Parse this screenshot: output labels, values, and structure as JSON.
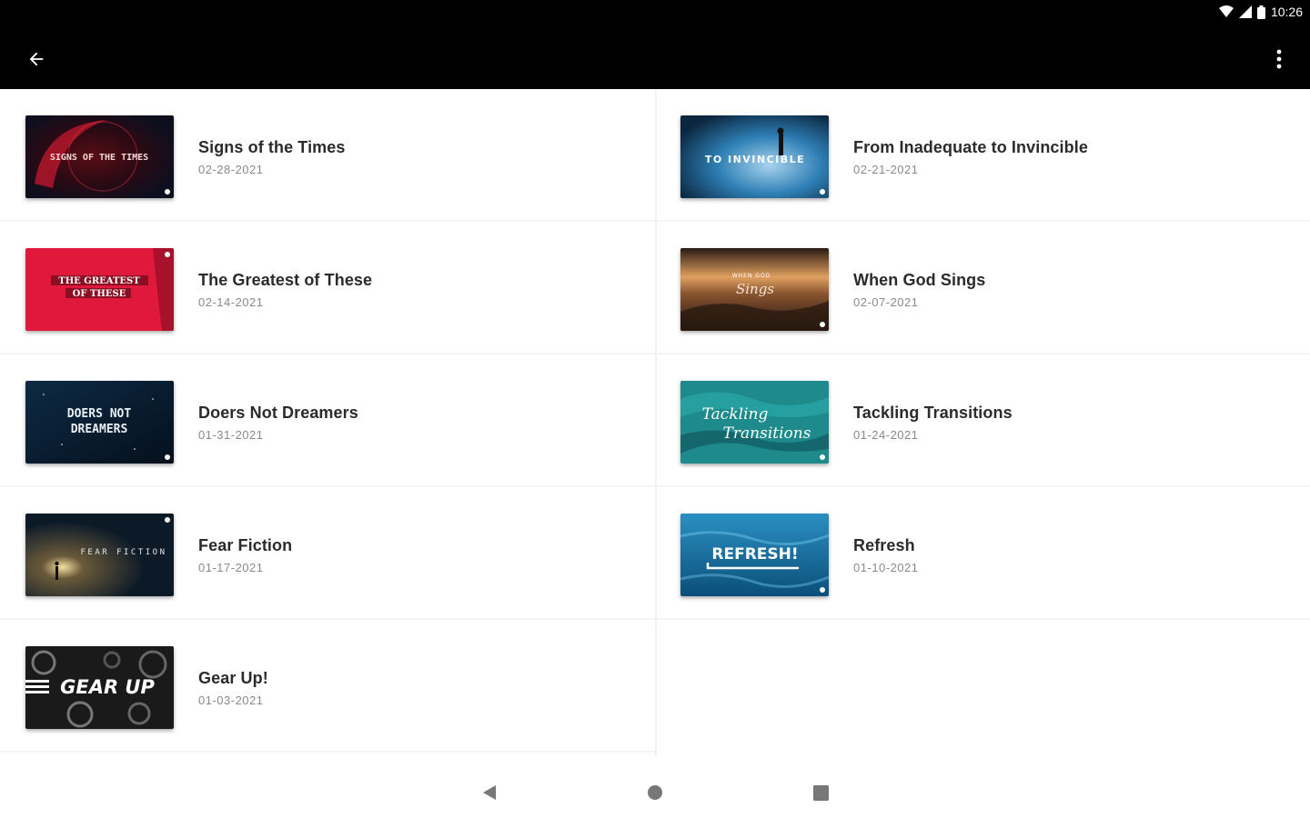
{
  "status_bar": {
    "time": "10:26",
    "icons": [
      "wifi-icon",
      "signal-icon",
      "battery-icon"
    ]
  },
  "app_bar": {
    "back_icon": "arrow-back-icon",
    "menu_icon": "more-vert-icon"
  },
  "sermons": [
    {
      "title": "Signs of the Times",
      "date": "02-28-2021",
      "thumb_text": "SIGNS OF THE TIMES"
    },
    {
      "title": "From Inadequate to Invincible",
      "date": "02-21-2021",
      "thumb_text": "TO INVINCIBLE"
    },
    {
      "title": "The Greatest of These",
      "date": "02-14-2021",
      "thumb_text": "THE GREATEST OF THESE"
    },
    {
      "title": "When God Sings",
      "date": "02-07-2021",
      "thumb_text": "WHEN GOD Sings"
    },
    {
      "title": "Doers Not Dreamers",
      "date": "01-31-2021",
      "thumb_text": "DOERS NOT DREAMERS"
    },
    {
      "title": "Tackling Transitions",
      "date": "01-24-2021",
      "thumb_text": "Tackling Transitions"
    },
    {
      "title": "Fear Fiction",
      "date": "01-17-2021",
      "thumb_text": "FEAR FICTION"
    },
    {
      "title": "Refresh",
      "date": "01-10-2021",
      "thumb_text": "REFRESH!"
    },
    {
      "title": "Gear Up!",
      "date": "01-03-2021",
      "thumb_text": "GEAR UP"
    }
  ],
  "nav_bar": {
    "icons": [
      "nav-back-icon",
      "nav-home-icon",
      "nav-recents-icon"
    ]
  },
  "colors": {
    "app_bar": "#000000",
    "title_text": "#2b2b2b",
    "date_text": "#8a8a8a"
  }
}
